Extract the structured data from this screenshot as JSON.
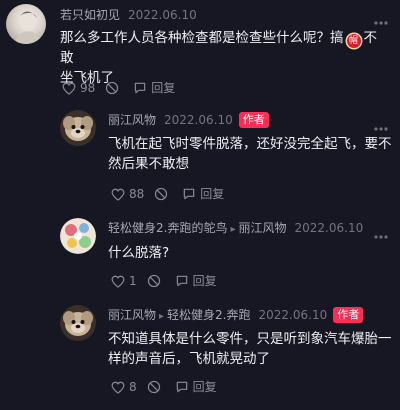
{
  "comments": [
    {
      "username": "若只如初见",
      "date": "2022.06.10",
      "text_line1": "那么多工作人员各种检查都是检查些什么呢？搞",
      "emoji_label": "帽",
      "text_line1_tail": "不敢",
      "text_line2": "坐飞机了",
      "likes": "98",
      "reply_label": "回复"
    },
    {
      "username": "丽江风物",
      "date": "2022.06.10",
      "badge": "作者",
      "text_line1": "飞机在起飞时零件脱落，还好没完全起飞，要不",
      "text_line2": "然后果不敢想",
      "likes": "88",
      "reply_label": "回复"
    },
    {
      "username": "轻松健身2.奔跑的鸵鸟",
      "reply_to": "丽江风物",
      "date": "2022.06.10",
      "text_line1": "什么脱落?",
      "likes": "1",
      "reply_label": "回复"
    },
    {
      "username": "丽江风物",
      "reply_to": "轻松健身2.奔跑",
      "date": "2022.06.10",
      "badge": "作者",
      "text_line1": "不知道具体是什么零件，只是听到象汽车爆胎一",
      "text_line2": "样的声音后，飞机就晃动了",
      "likes": "8",
      "reply_label": "回复"
    }
  ],
  "colors": {
    "background": "#161723",
    "author_badge": "#ff2d55",
    "meta_text": "#8b8b95"
  },
  "icons": [
    "heart-icon",
    "dislike-icon",
    "reply-icon",
    "more-dots-icon",
    "arrow-right-icon"
  ]
}
